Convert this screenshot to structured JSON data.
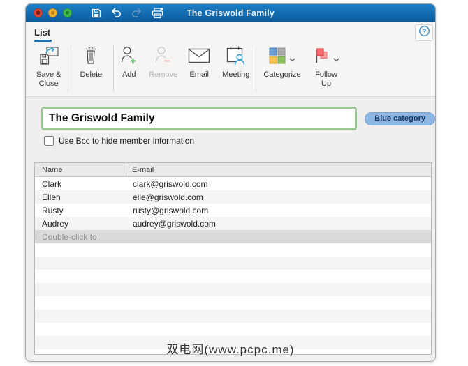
{
  "colors": {
    "accent_blue": "#1f6fb5",
    "titlebar_top": "#1e80c6",
    "titlebar_bottom": "#0c5b9d",
    "category_pill_blue": "#8db6e3",
    "name_field_border_green": "#9cc598"
  },
  "titlebar": {
    "title": "The Griswold Family",
    "icons": [
      "close",
      "minimize",
      "zoom",
      "save",
      "undo",
      "redo",
      "print"
    ]
  },
  "ribbon": {
    "tab_label": "List",
    "help_icon": "help-question-circle",
    "buttons": [
      {
        "lines": [
          "Save &",
          "Close"
        ],
        "icon": "save-close"
      },
      {
        "lines": [
          "Delete"
        ],
        "icon": "trash"
      },
      {
        "lines": [
          "Add"
        ],
        "icon": "person-add"
      },
      {
        "lines": [
          "Remove"
        ],
        "icon": "person-remove",
        "disabled": true
      },
      {
        "lines": [
          "Email"
        ],
        "icon": "envelope"
      },
      {
        "lines": [
          "Meeting"
        ],
        "icon": "calendar-person"
      },
      {
        "lines": [
          "Categorize"
        ],
        "icon": "color-squares",
        "has_dropdown": true
      },
      {
        "lines": [
          "Follow",
          "Up"
        ],
        "icon": "red-flag",
        "has_dropdown": true
      }
    ]
  },
  "form": {
    "list_name": "The Griswold Family",
    "category_badge": "Blue category",
    "bcc_checkbox_label": "Use Bcc to hide member information",
    "bcc_checked": false
  },
  "members": {
    "columns": [
      "Name",
      "E-mail"
    ],
    "rows": [
      {
        "name": "Clark",
        "email": "clark@griswold.com"
      },
      {
        "name": "Ellen",
        "email": "elle@griswold.com"
      },
      {
        "name": "Rusty",
        "email": "rusty@griswold.com"
      },
      {
        "name": "Audrey",
        "email": "audrey@griswold.com"
      }
    ],
    "placeholder": "Double-click to"
  },
  "watermark": "双电网(www.pcpc.me)"
}
